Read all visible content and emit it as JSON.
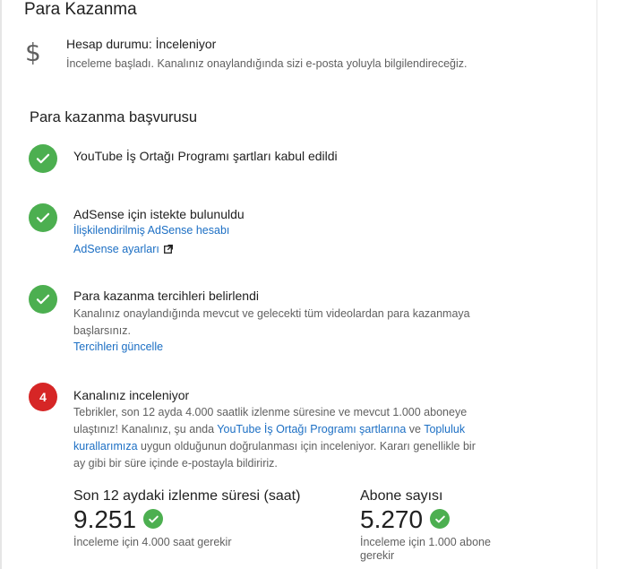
{
  "page": {
    "title": "Para Kazanma"
  },
  "status": {
    "icon": "dollar-icon",
    "icon_glyph": "$",
    "title": "Hesap durumu: İnceleniyor",
    "description": "İnceleme başladı. Kanalınız onaylandığında sizi e-posta yoluyla bilgilendireceğiz."
  },
  "application": {
    "title": "Para kazanma başvurusu",
    "steps": [
      {
        "state": "done",
        "title": "YouTube İş Ortağı Programı şartları kabul edildi"
      },
      {
        "state": "done",
        "title": "AdSense için istekte bulunuldu",
        "link_1": "İlişkilendirilmiş AdSense hesabı",
        "link_2": "AdSense ayarları"
      },
      {
        "state": "done",
        "title": "Para kazanma tercihleri belirlendi",
        "desc_line_1": "Kanalınız onaylandığında mevcut ve gelecekti tüm videolardan para kazanmaya",
        "desc_line_2": "başlarsınız.",
        "link": "Tercihleri güncelle"
      },
      {
        "state": "pending",
        "number": "4",
        "title": "Kanalınız inceleniyor",
        "desc_line_1": "Tebrikler, son 12 ayda 4.000 saatlik izlenme süresine ve mevcut 1.000 aboneye",
        "desc_line_2a": "ulaştınız! Kanalınız, şu anda ",
        "desc_link_1": "YouTube İş Ortağı Programı şartlarına",
        "desc_line_2b": " ve ",
        "desc_link_2a": "Topluluk",
        "desc_link_2b": "kurallarımıza",
        "desc_line_3": " uygun olduğunun doğrulanması için inceleniyor. Kararı genellikle bir",
        "desc_line_4": "ay gibi bir süre içinde e-postayla bildiririz."
      }
    ]
  },
  "stats": {
    "watch_time": {
      "label": "Son 12 aydaki izlenme süresi (saat)",
      "value": "9.251",
      "note": "İnceleme için 4.000 saat gerekir"
    },
    "subscribers": {
      "label": "Abone sayısı",
      "value": "5.270",
      "note_line_1": "İnceleme için 1.000 abone",
      "note_line_2": "gerekir"
    }
  },
  "colors": {
    "success": "#4caf50",
    "pending": "#d62626",
    "link": "#1c6fc4"
  }
}
